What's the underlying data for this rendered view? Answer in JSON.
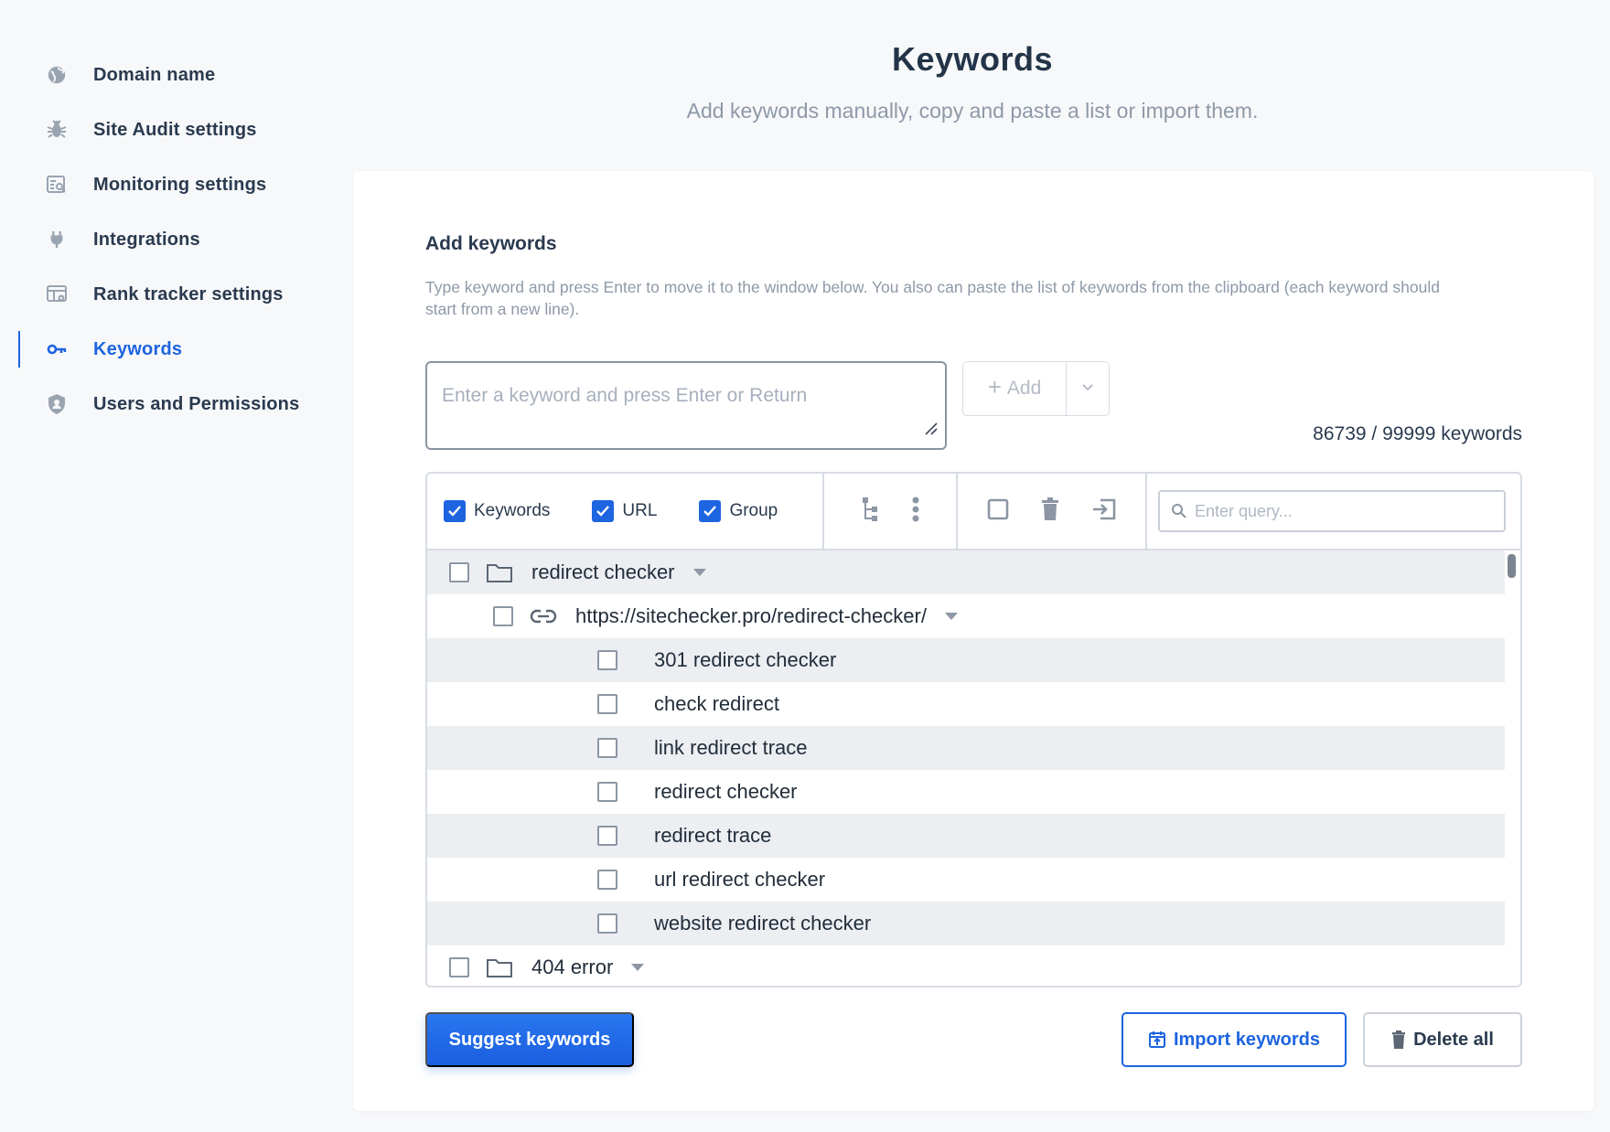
{
  "sidebar": {
    "items": [
      {
        "label": "Domain name",
        "icon": "globe-icon"
      },
      {
        "label": "Site Audit settings",
        "icon": "bug-icon"
      },
      {
        "label": "Monitoring settings",
        "icon": "monitor-search-icon"
      },
      {
        "label": "Integrations",
        "icon": "plug-icon"
      },
      {
        "label": "Rank tracker settings",
        "icon": "table-settings-icon"
      },
      {
        "label": "Keywords",
        "icon": "key-icon",
        "active": true
      },
      {
        "label": "Users and Permissions",
        "icon": "shield-user-icon"
      }
    ]
  },
  "header": {
    "title": "Keywords",
    "subtitle": "Add keywords manually, copy and paste a list or import them."
  },
  "add_keywords": {
    "title": "Add keywords",
    "hint": "Type keyword and press Enter to move it to the window below. You also can paste the list of keywords from the clipboard (each keyword should start from a new line).",
    "input_placeholder": "Enter a keyword and press Enter or Return",
    "add_label": "Add",
    "counter": "86739 / 99999 keywords"
  },
  "toolbar": {
    "checks": [
      {
        "label": "Keywords",
        "checked": true
      },
      {
        "label": "URL",
        "checked": true
      },
      {
        "label": "Group",
        "checked": true
      }
    ],
    "search_placeholder": "Enter query..."
  },
  "tree": {
    "group1": "redirect checker",
    "url1": "https://sitechecker.pro/redirect-checker/",
    "keywords": [
      "301 redirect checker",
      "check redirect",
      "link redirect trace",
      "redirect checker",
      "redirect trace",
      "url redirect checker",
      "website redirect checker"
    ],
    "group2": "404 error"
  },
  "buttons": {
    "suggest": "Suggest keywords",
    "import": "Import keywords",
    "delete": "Delete all"
  },
  "colors": {
    "accent": "#1d64e0",
    "text": "#2a3a4f",
    "muted": "#8e99a8",
    "row_shade": "#eceef2"
  }
}
